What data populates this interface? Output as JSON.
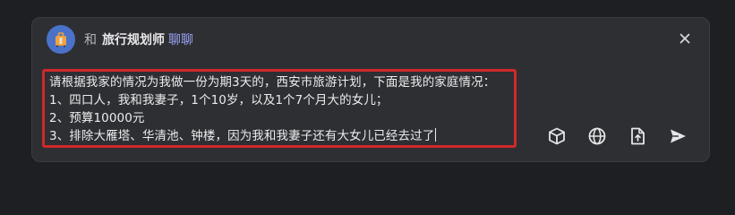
{
  "header": {
    "prefix": "和",
    "agent_name": "旅行规划师",
    "suffix": "聊聊"
  },
  "input": {
    "lines": [
      "请根据我家的情况为我做一份为期3天的，西安市旅游计划，下面是我的家庭情况：",
      "1、四口人，我和我妻子，1个10岁，以及1个7个月大的女儿；",
      "2、预算10000元",
      "3、排除大雁塔、华清池、钟楼，因为我和我妻子还有大女儿已经去过了"
    ]
  },
  "toolbar": {
    "icons": [
      "cube-icon",
      "globe-icon",
      "file-upload-icon",
      "send-icon"
    ]
  },
  "colors": {
    "background": "#1e1f22",
    "panel": "#2e2f33",
    "highlight_border": "#d0282b",
    "avatar": "#4a72c9",
    "accent_text": "#9aa3f5"
  }
}
